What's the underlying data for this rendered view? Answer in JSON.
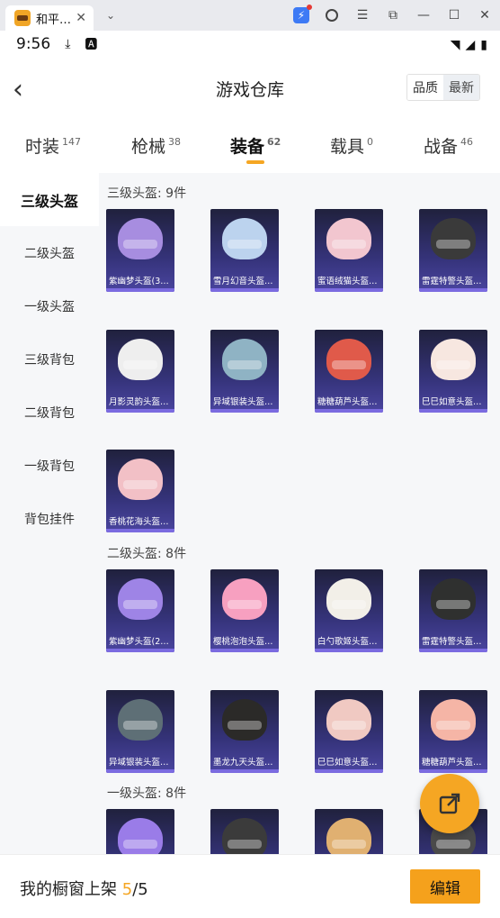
{
  "window": {
    "tab_title": "和平…",
    "controls": [
      "bolt-icon",
      "user-icon",
      "menu-icon",
      "crop-icon",
      "minimize-icon",
      "maximize-icon",
      "close-icon"
    ]
  },
  "status": {
    "time": "9:56"
  },
  "header": {
    "title": "游戏仓库",
    "sort_quality": "品质",
    "sort_newest": "最新"
  },
  "categories": [
    {
      "label": "时装",
      "count": "147"
    },
    {
      "label": "枪械",
      "count": "38"
    },
    {
      "label": "装备",
      "count": "62",
      "active": true
    },
    {
      "label": "载具",
      "count": "0"
    },
    {
      "label": "战备",
      "count": "46"
    }
  ],
  "sidebar": [
    {
      "label": "三级头盔",
      "active": true
    },
    {
      "label": "二级头盔"
    },
    {
      "label": "一级头盔"
    },
    {
      "label": "三级背包"
    },
    {
      "label": "二级背包"
    },
    {
      "label": "一级背包"
    },
    {
      "label": "背包挂件"
    }
  ],
  "sections": [
    {
      "title": "三级头盔: 9件",
      "items": [
        "紫幽梦头盔(3…",
        "雪月幻音头盔…",
        "蜜语绒猫头盔…",
        "雷霆特警头盔…",
        "月影灵韵头盔…",
        "异域银装头盔…",
        "糖糖葫芦头盔…",
        "巳巳如意头盔…",
        "香桃花海头盔…"
      ]
    },
    {
      "title": "二级头盔: 8件",
      "items": [
        "紫幽梦头盔(2…",
        "樱桃泡泡头盔…",
        "白勺歌姬头盔…",
        "雷霆特警头盔…",
        "异域银装头盔…",
        "墨龙九天头盔…",
        "巳巳如意头盔…",
        "糖糖葫芦头盔…"
      ]
    },
    {
      "title": "一级头盔: 8件",
      "items": [
        "",
        "",
        "",
        ""
      ]
    }
  ],
  "helmet_colors": [
    "#a78de0",
    "#bcd3ee",
    "#f2c6cf",
    "#3a3a3a",
    "#eeeeee",
    "#8fb3c4",
    "#e05a4a",
    "#f7e7e0",
    "#f2c0c6",
    "#9e84e6",
    "#f7a0c0",
    "#f2efe8",
    "#2f302f",
    "#5e6f76",
    "#2b2a28",
    "#f0c9c2",
    "#f5b5a6",
    "#9a7ce8",
    "#3b3b3b",
    "#e0b071",
    "#4a4a4a"
  ],
  "bottom": {
    "label": "我的橱窗上架 ",
    "count": "5",
    "total": "/5",
    "edit": "编辑"
  }
}
